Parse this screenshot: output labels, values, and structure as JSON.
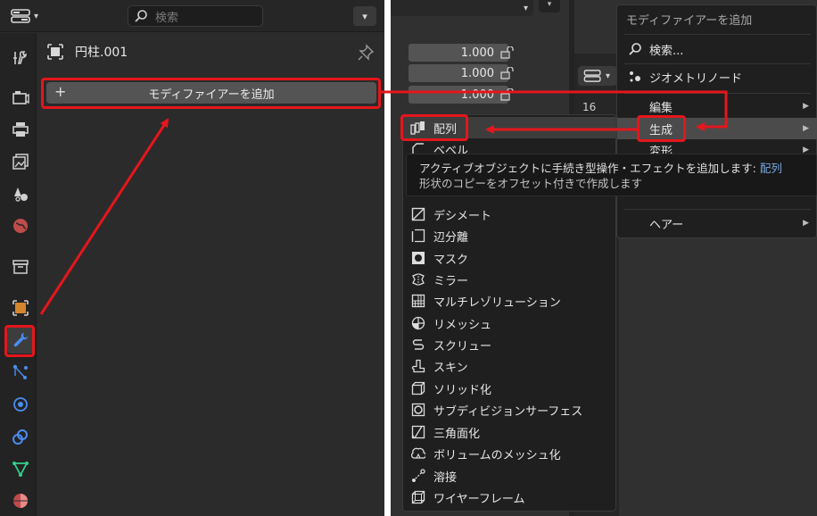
{
  "left": {
    "search_placeholder": "検索",
    "object_name": "円柱.001",
    "add_modifier_plus": "+",
    "add_modifier_label": "モディファイアーを追加",
    "tabs": [
      {
        "icon": "tool-icon"
      },
      {
        "icon": "render-icon"
      },
      {
        "icon": "output-icon"
      },
      {
        "icon": "view-layer-icon"
      },
      {
        "icon": "scene-icon"
      },
      {
        "icon": "world-icon"
      },
      {
        "icon": "collection-icon"
      },
      {
        "icon": "object-icon"
      },
      {
        "icon": "modifier-wrench-icon",
        "active": true
      },
      {
        "icon": "particles-icon"
      },
      {
        "icon": "physics-icon"
      },
      {
        "icon": "constraints-icon"
      },
      {
        "icon": "object-data-mesh-icon"
      },
      {
        "icon": "material-icon"
      }
    ]
  },
  "right": {
    "fields": [
      "1.000",
      "1.000",
      "1.000"
    ],
    "frame_num": "16",
    "menu": {
      "title": "モディファイアーを追加",
      "search": "検索...",
      "geometry_nodes": "ジオメトリノード",
      "edit": "編集",
      "generate": "生成",
      "deform": "変形",
      "hair": "ヘアー"
    },
    "submenu": {
      "items": [
        {
          "label": "配列",
          "icon": "array-icon"
        },
        {
          "label": "ベベル",
          "icon": "bevel-icon"
        },
        {
          "label": "デシメート",
          "icon": "decimate-icon"
        },
        {
          "label": "辺分離",
          "icon": "edge-split-icon"
        },
        {
          "label": "マスク",
          "icon": "mask-icon"
        },
        {
          "label": "ミラー",
          "icon": "mirror-icon"
        },
        {
          "label": "マルチレゾリューション",
          "icon": "multires-icon"
        },
        {
          "label": "リメッシュ",
          "icon": "remesh-icon"
        },
        {
          "label": "スクリュー",
          "icon": "screw-icon"
        },
        {
          "label": "スキン",
          "icon": "skin-icon"
        },
        {
          "label": "ソリッド化",
          "icon": "solidify-icon"
        },
        {
          "label": "サブディビジョンサーフェス",
          "icon": "subsurf-icon"
        },
        {
          "label": "三角面化",
          "icon": "triangulate-icon"
        },
        {
          "label": "ボリュームのメッシュ化",
          "icon": "volume-to-mesh-icon"
        },
        {
          "label": "溶接",
          "icon": "weld-icon"
        },
        {
          "label": "ワイヤーフレーム",
          "icon": "wireframe-icon"
        }
      ]
    },
    "tooltip": {
      "line1": "アクティブオブジェクトに手続き型操作・エフェクトを追加します: ",
      "python": "配列",
      "line2": "形状のコピーをオフセット付きで作成します"
    }
  },
  "annotation_color": "#e5161c"
}
